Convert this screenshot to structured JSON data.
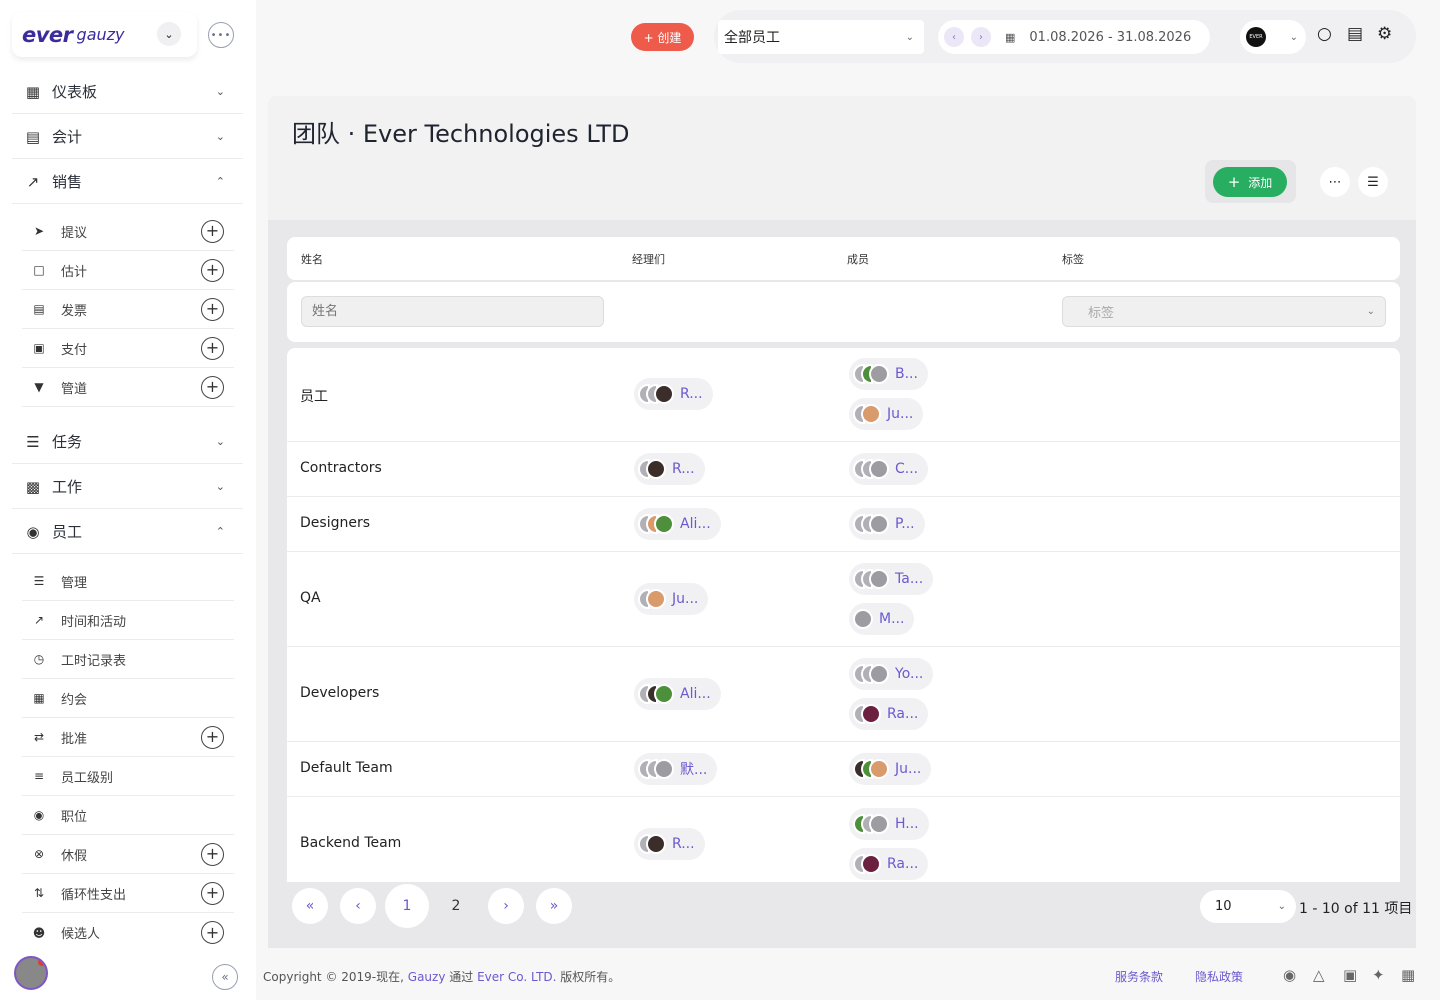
{
  "brand": {
    "ever": "ever",
    "gauzy": "gauzy"
  },
  "nav": {
    "dashboard": "仪表板",
    "accounting": "会计",
    "sales": "销售",
    "sales_items": [
      "提议",
      "估计",
      "发票",
      "支付",
      "管道"
    ],
    "tasks": "任务",
    "jobs": "工作",
    "employees": "员工",
    "employee_items": [
      "管理",
      "时间和活动",
      "工时记录表",
      "约会",
      "批准",
      "员工级别",
      "职位",
      "休假",
      "循环性支出",
      "候选人"
    ]
  },
  "header": {
    "create_label": "+ 创建",
    "employee_select": "全部员工",
    "date_range": "01.08.2026 - 31.08.2026",
    "org_logo_text": "EVER"
  },
  "page": {
    "title": "团队 · Ever Technologies LTD",
    "add_label": "添加"
  },
  "table": {
    "headers": {
      "name": "姓名",
      "managers": "经理们",
      "members": "成员",
      "tags": "标签"
    },
    "filters": {
      "name_placeholder": "姓名",
      "tags_placeholder": "标签"
    },
    "rows": [
      {
        "name": "员工",
        "managers": [
          "R..."
        ],
        "members": [
          "B...",
          "Ju..."
        ]
      },
      {
        "name": "Contractors",
        "managers": [
          "R..."
        ],
        "members": [
          "C..."
        ]
      },
      {
        "name": "Designers",
        "managers": [
          "Ali..."
        ],
        "members": [
          "P..."
        ]
      },
      {
        "name": "QA",
        "managers": [
          "Ju..."
        ],
        "members": [
          "Ta...",
          "M..."
        ]
      },
      {
        "name": "Developers",
        "managers": [
          "Ali..."
        ],
        "members": [
          "Yo...",
          "Ra..."
        ]
      },
      {
        "name": "Default Team",
        "managers": [
          "默..."
        ],
        "members": [
          "Ju..."
        ]
      },
      {
        "name": "Backend Team",
        "managers": [
          "R..."
        ],
        "members": [
          "H...",
          "Ra..."
        ]
      }
    ]
  },
  "pagination": {
    "pages": [
      "1",
      "2"
    ],
    "current": "1",
    "per_page": "10",
    "range": "1 - 10 of 11 项目"
  },
  "footer": {
    "copyright_pre": "Copyright © 2019-现在, ",
    "gauzy": "Gauzy",
    "by": " 通过 ",
    "company": "Ever Co. LTD.",
    "rights": " 版权所有。",
    "terms": "服务条款",
    "privacy": "隐私政策"
  }
}
